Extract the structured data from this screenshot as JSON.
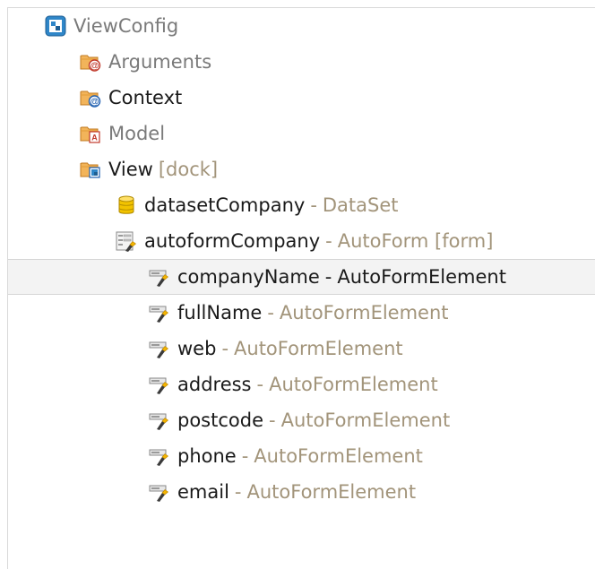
{
  "tree": {
    "root": {
      "label": "ViewConfig"
    },
    "arguments": {
      "label": "Arguments"
    },
    "context": {
      "label": "Context"
    },
    "model": {
      "label": "Model"
    },
    "view": {
      "label": "View",
      "meta": "[dock]"
    },
    "dataset": {
      "label": "datasetCompany",
      "sep": "-",
      "type": "DataSet"
    },
    "autoform": {
      "label": "autoformCompany",
      "sep": "-",
      "type": "AutoForm [form]"
    },
    "elements": [
      {
        "label": "companyName",
        "sep": "-",
        "type": "AutoFormElement",
        "selected": true
      },
      {
        "label": "fullName",
        "sep": "-",
        "type": "AutoFormElement"
      },
      {
        "label": "web",
        "sep": "-",
        "type": "AutoFormElement"
      },
      {
        "label": "address",
        "sep": "-",
        "type": "AutoFormElement"
      },
      {
        "label": "postcode",
        "sep": "-",
        "type": "AutoFormElement"
      },
      {
        "label": "phone",
        "sep": "-",
        "type": "AutoFormElement"
      },
      {
        "label": "email",
        "sep": "-",
        "type": "AutoFormElement"
      }
    ]
  },
  "colors": {
    "type_text": "#a2947a",
    "muted_text": "#7a7a7a",
    "selection_bg": "#f3f3f3"
  },
  "icons": {
    "root": "viewconfig-icon",
    "arguments": "arguments-folder-icon",
    "context": "context-folder-icon",
    "model": "model-folder-icon",
    "view": "view-folder-icon",
    "dataset": "dataset-icon",
    "autoform": "autoform-icon",
    "element": "autoform-element-icon"
  }
}
